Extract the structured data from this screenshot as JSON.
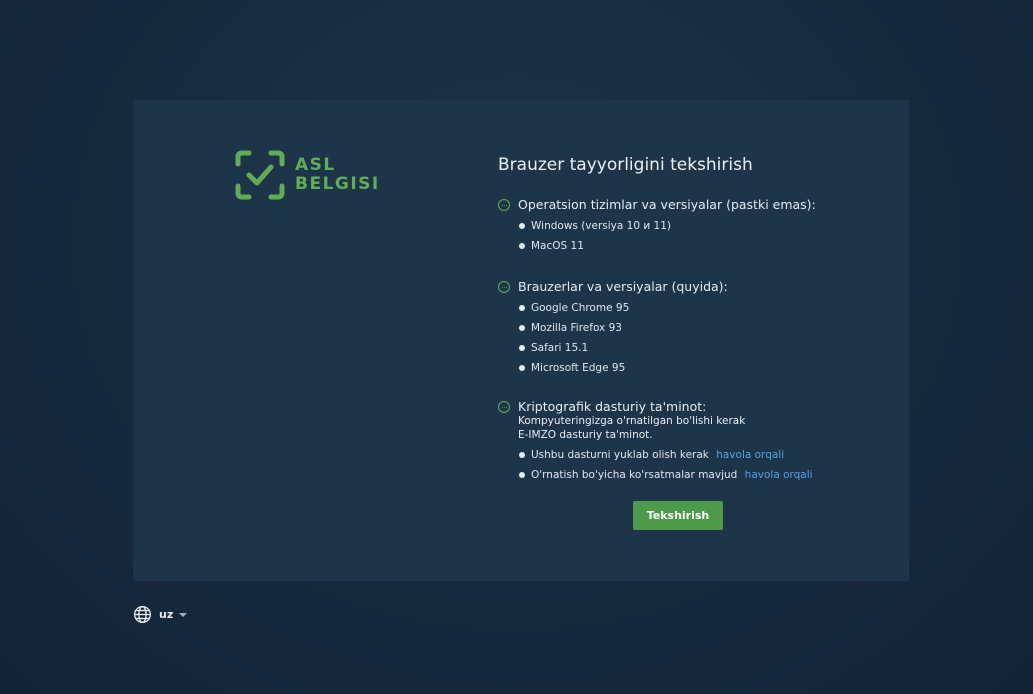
{
  "brand": {
    "line1": "ASL",
    "line2": "BELGISI",
    "color": "#5fae57"
  },
  "page": {
    "title": "Brauzer tayyorligini tekshirish"
  },
  "sections": [
    {
      "icon": "pending-status-icon",
      "title": "Operatsion tizimlar va versiyalar (pastki emas):",
      "items": [
        "Windows (versiya 10 и 11)",
        "MacOS 11"
      ]
    },
    {
      "icon": "pending-status-icon",
      "title": "Brauzerlar va versiyalar (quyida):",
      "items": [
        "Google Chrome 95",
        "Mozilla Firefox 93",
        "Safari 15.1",
        "Microsoft Edge 95"
      ]
    },
    {
      "icon": "pending-status-icon",
      "title": "Kriptografik dasturiy ta'minot:",
      "description": [
        "Kompyuteringizga o'rnatilgan bo'lishi kerak",
        "E-IMZO dasturiy ta'minot."
      ],
      "items": [
        {
          "text": "Ushbu dasturni yuklab olish kerak",
          "link": "havola orqali"
        },
        {
          "text": "O'rnatish bo'yicha ko'rsatmalar mavjud",
          "link": "havola orqali"
        }
      ]
    }
  ],
  "check_button": {
    "label": "Tekshirish",
    "color": "#4d9a4b"
  },
  "language": {
    "icon": "globe-icon",
    "code": "uz"
  },
  "colors": {
    "background": "#172a3d",
    "card": "#1e3449",
    "link": "#4fa3e6",
    "accent": "#5fae57"
  }
}
